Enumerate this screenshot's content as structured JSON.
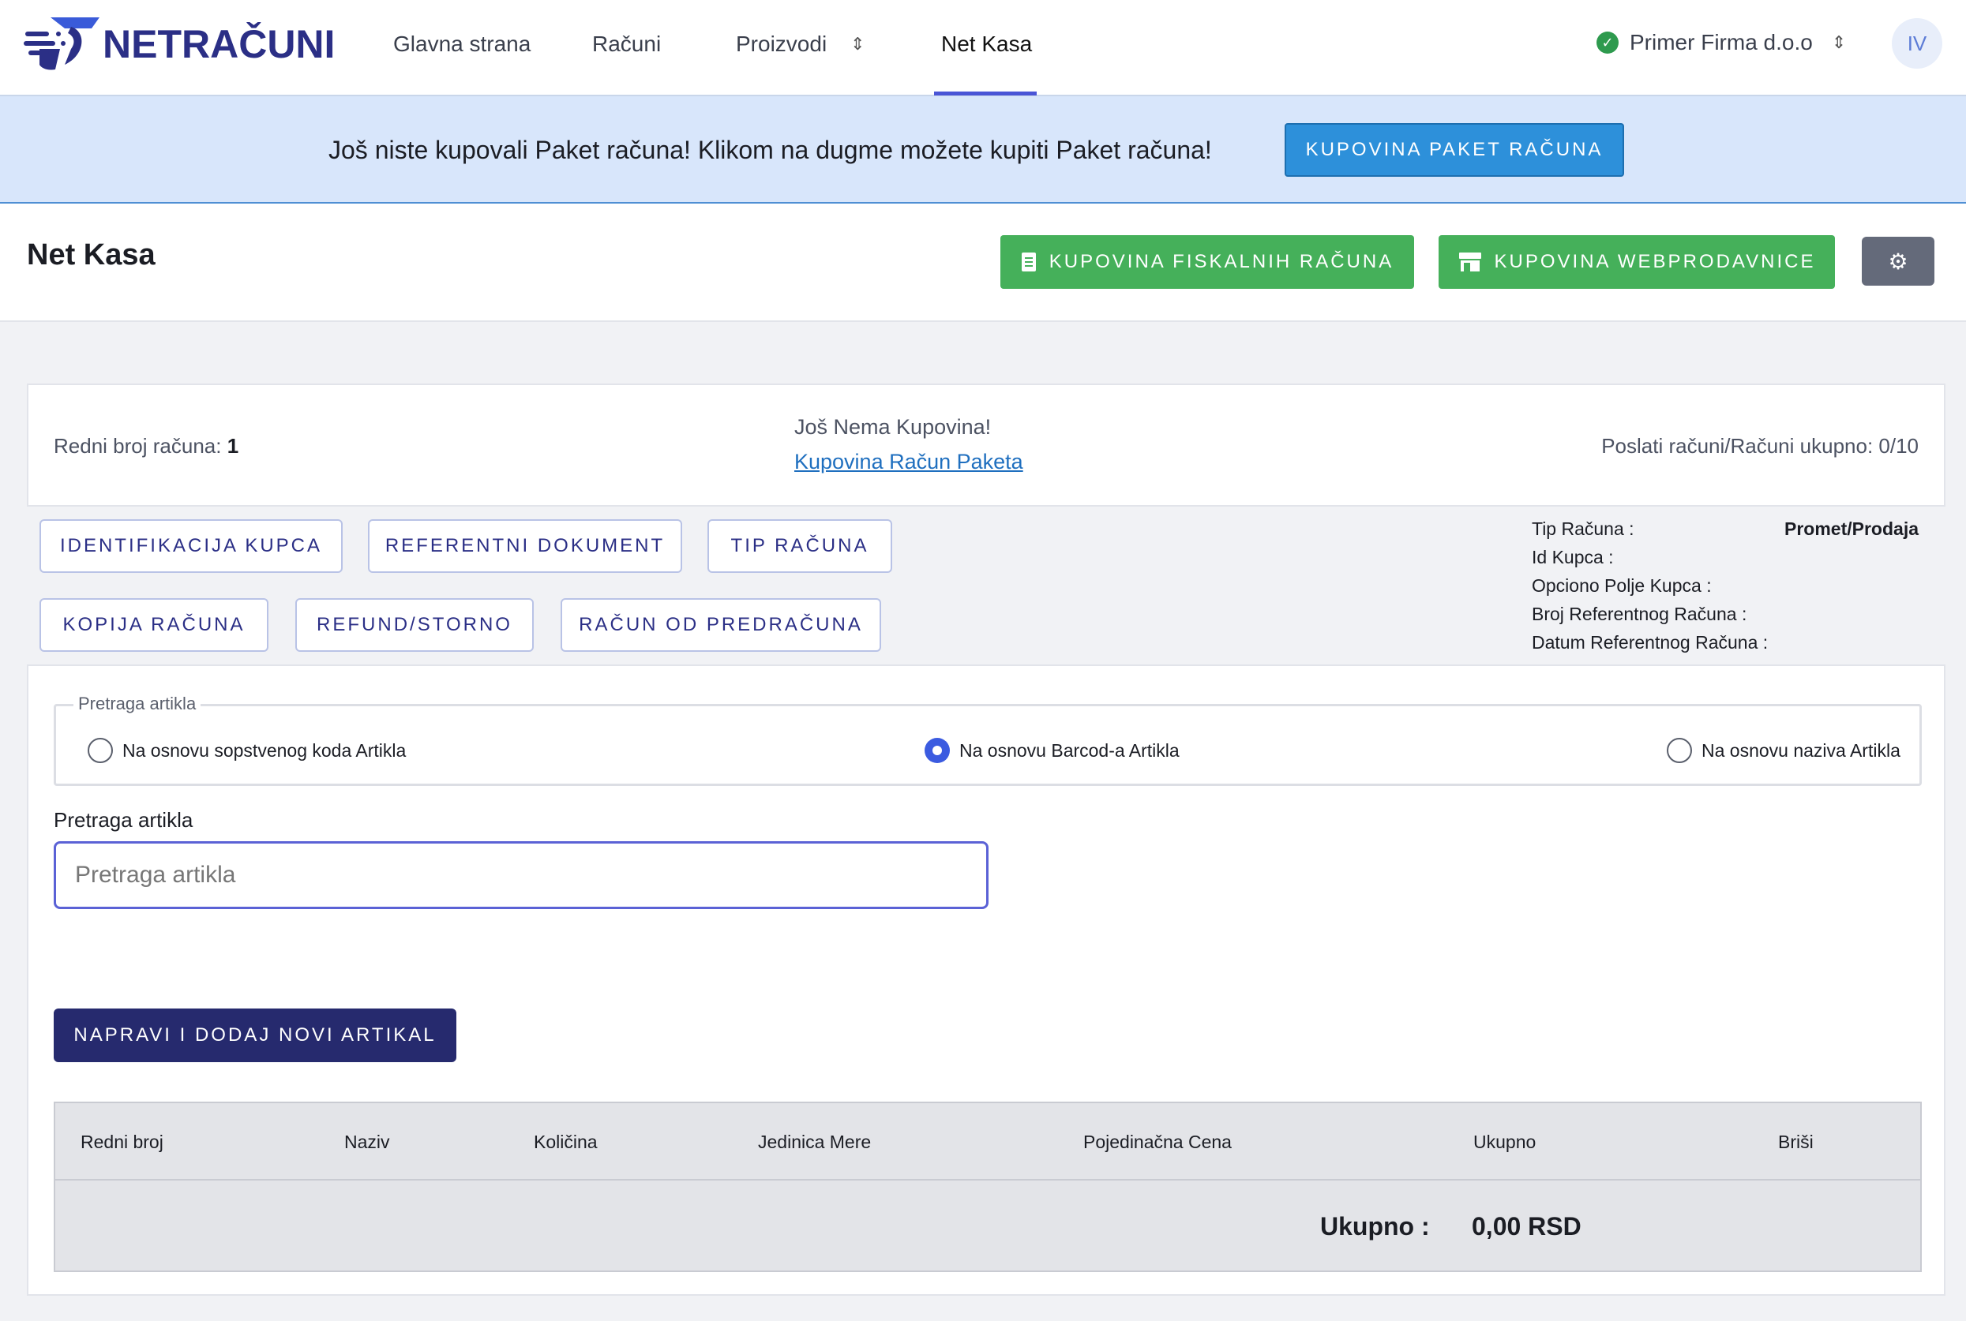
{
  "nav": {
    "logo_text": "NETRAČUNI",
    "links": [
      "Glavna strana",
      "Računi",
      "Proizvodi",
      "Net Kasa"
    ],
    "firm": "Primer Firma d.o.o",
    "avatar": "IV",
    "icons": {
      "firm_status": "check-circle-icon",
      "dropdown": "chevron-updown-icon"
    }
  },
  "banner": {
    "text": "Još niste kupovali Paket računa! Klikom na dugme možete kupiti Paket računa!",
    "button": "KUPOVINA PAKET RAČUNA"
  },
  "page": {
    "title": "Net Kasa",
    "btn_fiskalni": "KUPOVINA FISKALNIH RAČUNA",
    "btn_web": "KUPOVINA WEBPRODAVNICE"
  },
  "info": {
    "redni_label": "Redni broj računa:",
    "redni_value": "1",
    "nema": "Još Nema Kupovina!",
    "link": "Kupovina Račun Paketa",
    "poslati": "Poslati računi/Računi ukupno: 0/10"
  },
  "actions": {
    "identifikacija": "IDENTIFIKACIJA KUPCA",
    "referentni": "REFERENTNI DOKUMENT",
    "tip": "TIP RAČUNA",
    "kopija": "KOPIJA RAČUNA",
    "refund": "REFUND/STORNO",
    "predracun": "RAČUN OD PREDRAČUNA"
  },
  "meta": {
    "tip_label": "Tip Računa :",
    "tip_value": "Promet/Prodaja",
    "id_label": "Id Kupca :",
    "opciono_label": "Opciono Polje Kupca :",
    "broj_label": "Broj Referentnog Računa :",
    "datum_label": "Datum Referentnog Računa :"
  },
  "search": {
    "legend": "Pretraga artikla",
    "radio1": "Na osnovu sopstvenog koda Artikla",
    "radio2": "Na osnovu Barcod-a Artikla",
    "radio3": "Na osnovu naziva Artikla",
    "selected": "radio2",
    "label": "Pretraga artikla",
    "placeholder": "Pretraga artikla",
    "value": ""
  },
  "add_button": "NAPRAVI I DODAJ NOVI ARTIKAL",
  "table": {
    "columns": [
      "Redni broj",
      "Naziv",
      "Količina",
      "Jedinica Mere",
      "Pojedinačna Cena",
      "Ukupno",
      "Briši"
    ],
    "total_label": "Ukupno :",
    "total_value": "0,00 RSD"
  },
  "colors": {
    "brand": "#2b2f86",
    "accent_blue": "#2d90da",
    "green": "#45b05a",
    "navy": "#262a6e",
    "banner_bg": "#d8e6fb"
  }
}
